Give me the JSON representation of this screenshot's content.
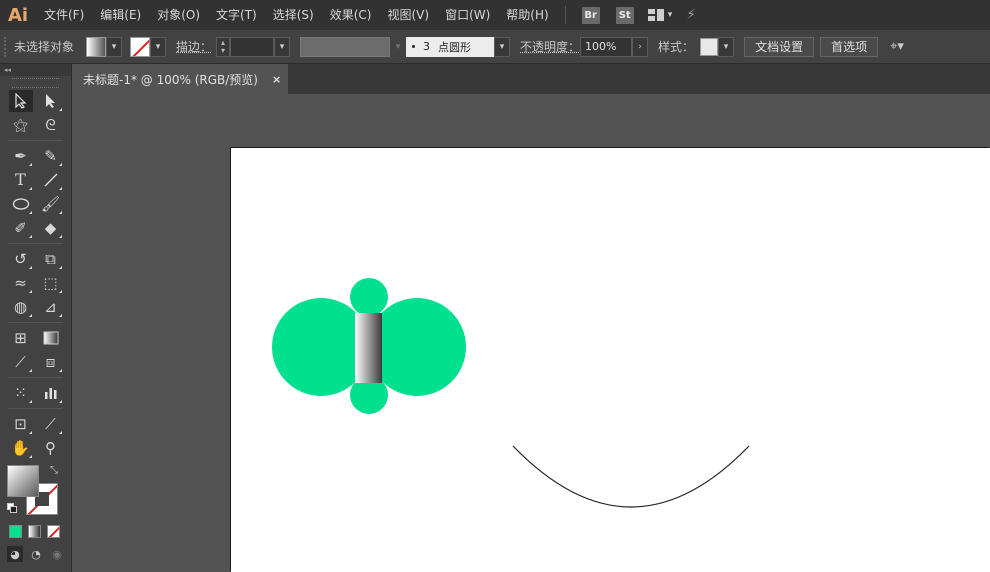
{
  "app": {
    "logo": "Ai",
    "menu": [
      "文件(F)",
      "编辑(E)",
      "对象(O)",
      "文字(T)",
      "选择(S)",
      "效果(C)",
      "视图(V)",
      "窗口(W)",
      "帮助(H)"
    ],
    "bridge_label": "Br",
    "stock_label": "St"
  },
  "control": {
    "selection_label": "未选择对象",
    "stroke_label": "描边：",
    "brush_size": "3",
    "brush_name": "点圆形",
    "opacity_label": "不透明度：",
    "opacity_value": "100%",
    "style_label": "样式：",
    "doc_setup_button": "文档设置",
    "preferences_button": "首选项"
  },
  "toolbar": {
    "collapse_glyph": "◂◂",
    "close_glyph": "×",
    "swap_glyph": "⤡"
  },
  "document": {
    "tab_title": "未标题-1* @ 100% (RGB/预览)",
    "close_glyph": "×"
  },
  "colors": {
    "accent_green": "#00e08f",
    "ui_dark": "#323232",
    "ui_panel": "#424242",
    "canvas_bg": "#535353"
  }
}
